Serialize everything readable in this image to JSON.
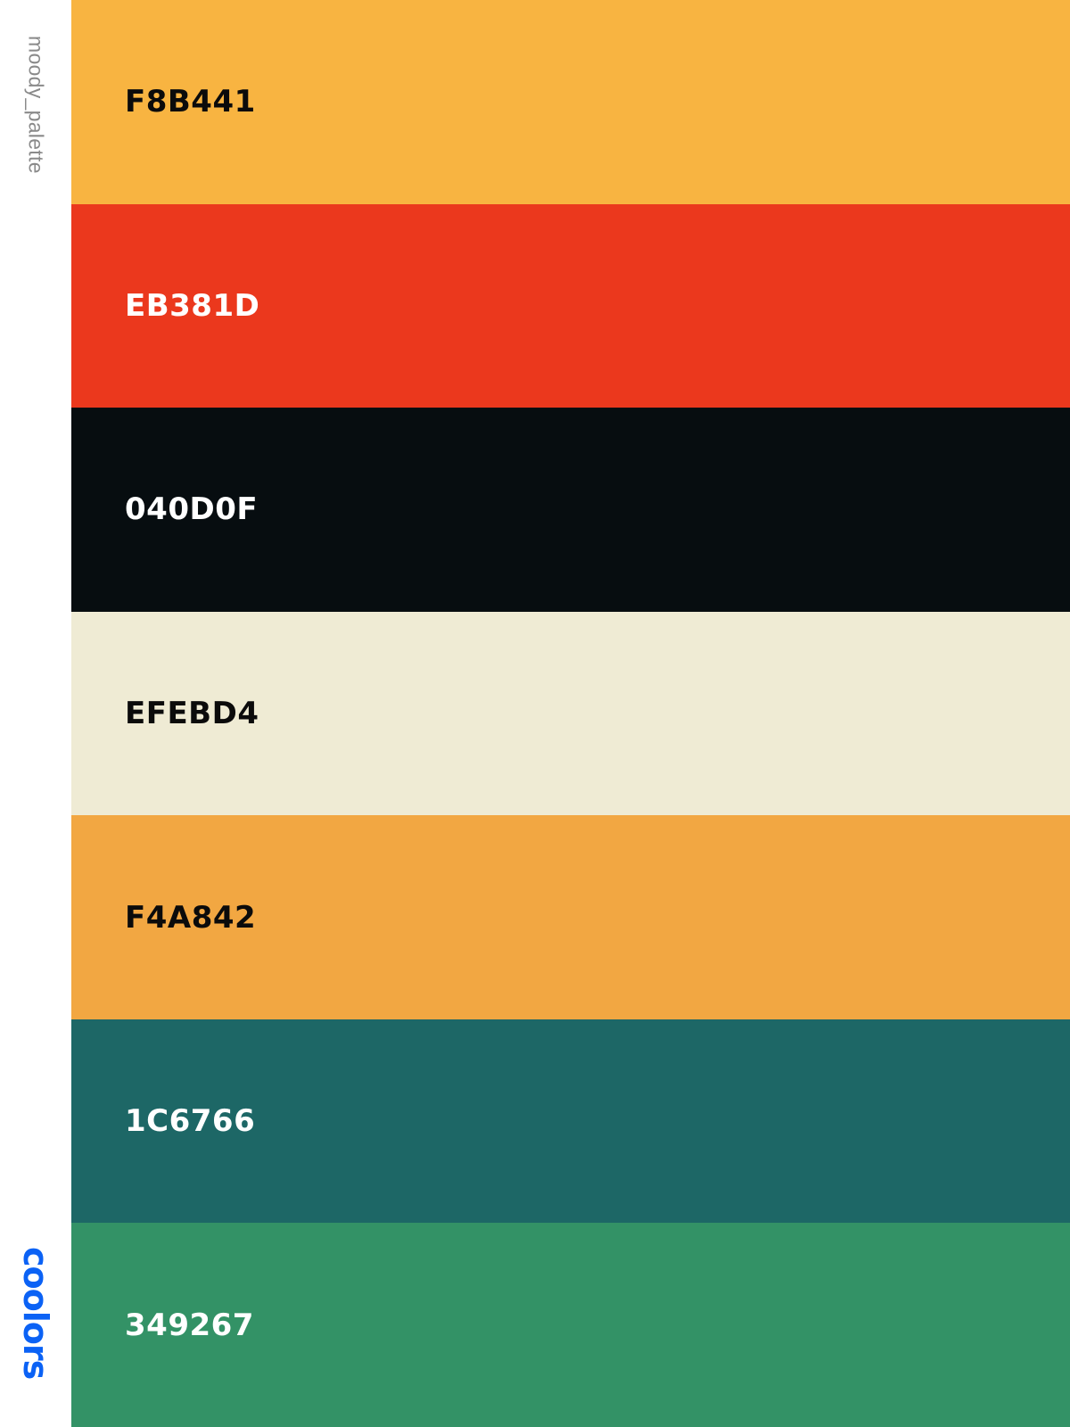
{
  "palette": {
    "name": "moody_palette",
    "swatches": [
      {
        "hex": "F8B441",
        "color": "#F8B441",
        "text_color": "#0b0b0b"
      },
      {
        "hex": "EB381D",
        "color": "#EB381D",
        "text_color": "#ffffff"
      },
      {
        "hex": "040D0F",
        "color": "#070D10",
        "text_color": "#ffffff"
      },
      {
        "hex": "EFEBD4",
        "color": "#EFEBD4",
        "text_color": "#0b0b0b"
      },
      {
        "hex": "F4A842",
        "color": "#F2A742",
        "text_color": "#0b0b0b"
      },
      {
        "hex": "1C6766",
        "color": "#1D6766",
        "text_color": "#ffffff"
      },
      {
        "hex": "349267",
        "color": "#339266",
        "text_color": "#ffffff"
      }
    ]
  },
  "brand": {
    "logo_text": "coolors",
    "color": "#0B62F5"
  }
}
